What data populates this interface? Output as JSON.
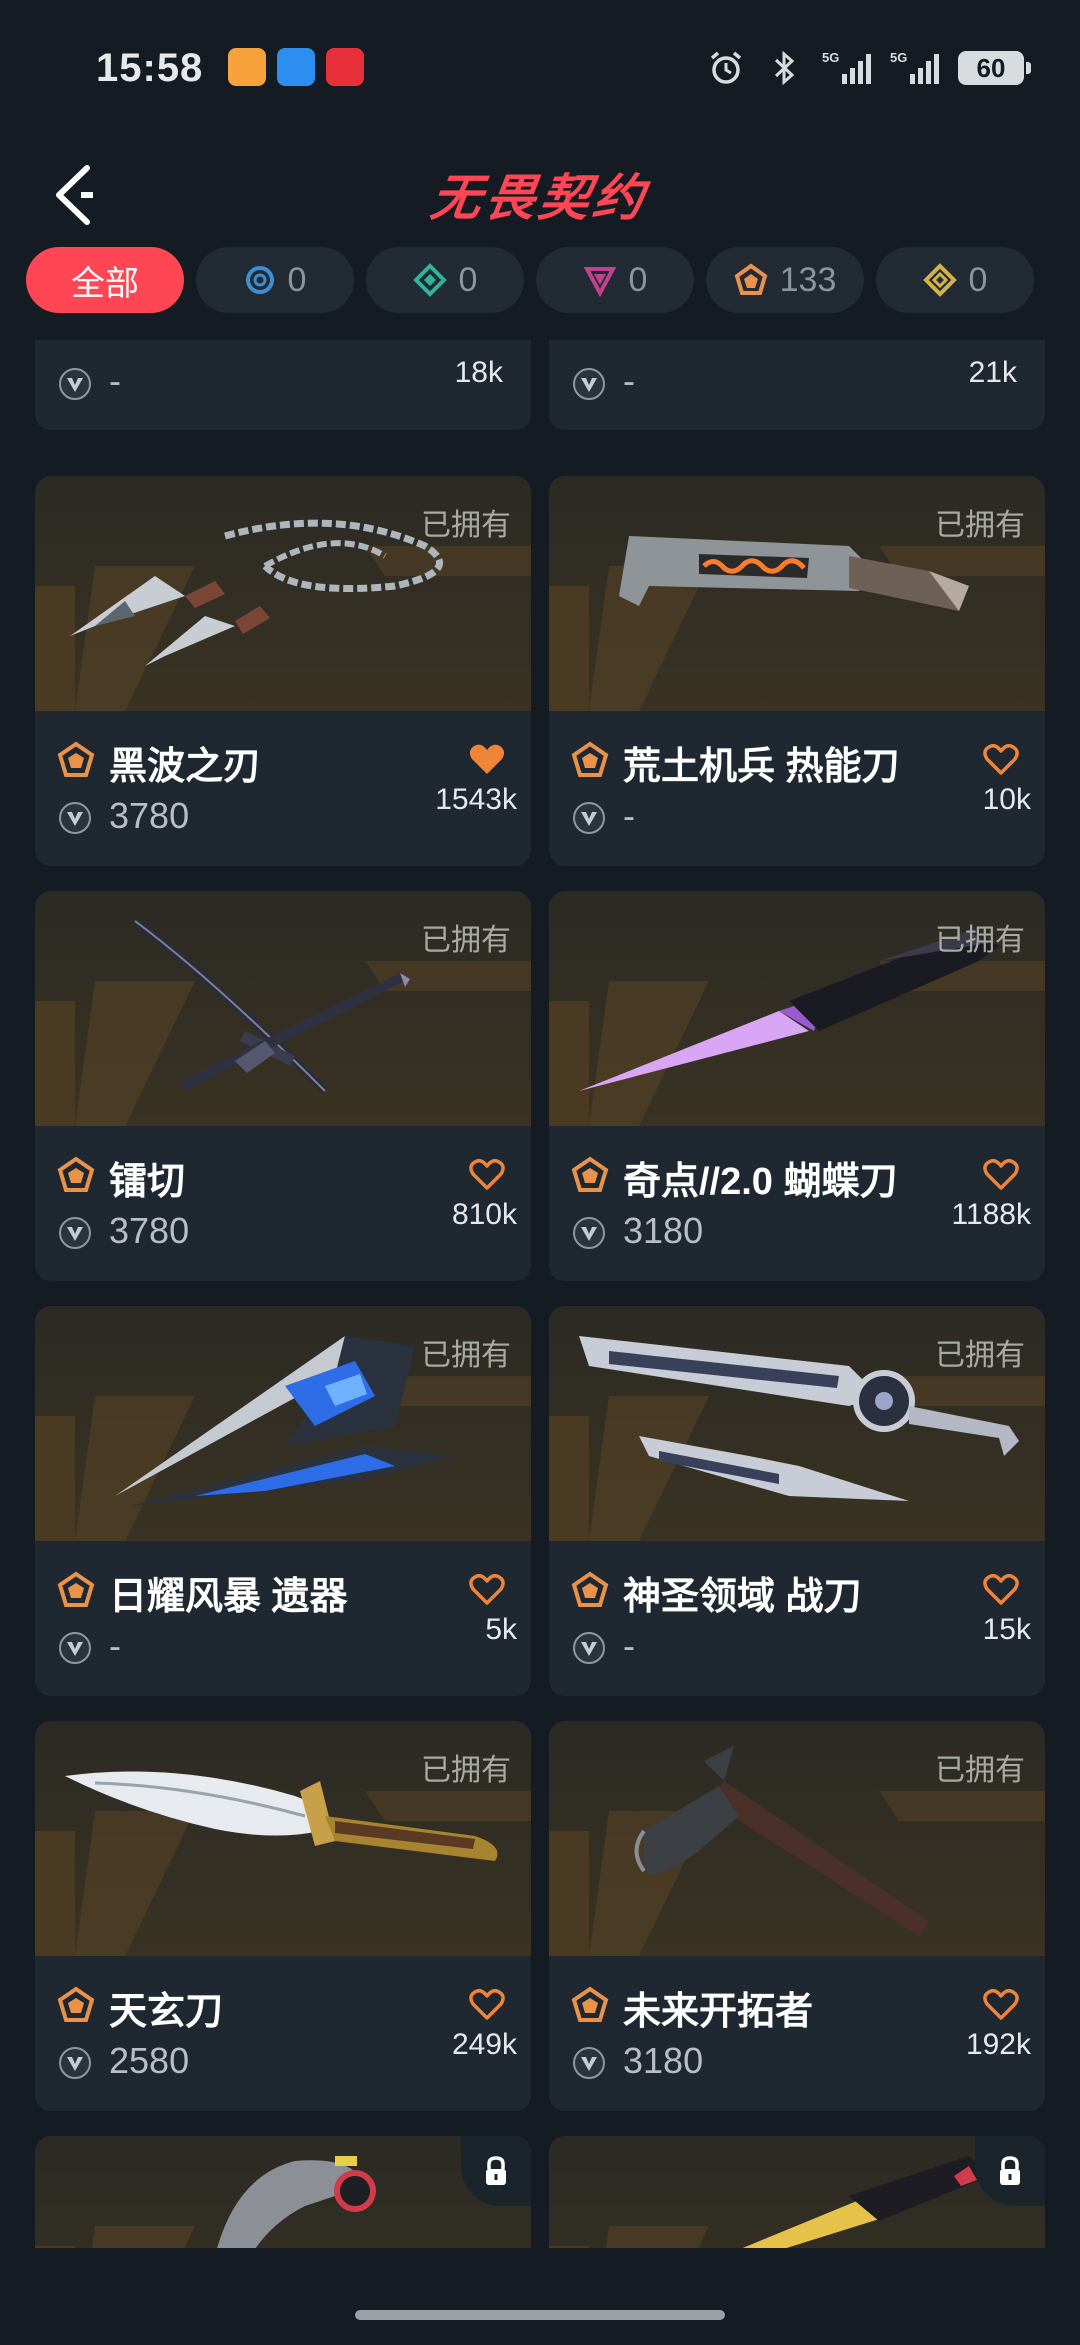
{
  "status_bar": {
    "time": "15:58",
    "battery": "60"
  },
  "header": {
    "title": "无畏契约"
  },
  "tabs": [
    {
      "label": "全部"
    },
    {
      "label": "0",
      "tier": "select"
    },
    {
      "label": "0",
      "tier": "deluxe"
    },
    {
      "label": "0",
      "tier": "premium"
    },
    {
      "label": "133",
      "tier": "exclusive"
    },
    {
      "label": "0",
      "tier": "ultra"
    }
  ],
  "partial_cards": [
    {
      "price": "-",
      "likes": "18k"
    },
    {
      "price": "-",
      "likes": "21k"
    }
  ],
  "cards": [
    {
      "name": "黑波之刃",
      "owned_label": "已拥有",
      "price": "3780",
      "likes": "1543k",
      "favorited": true
    },
    {
      "name": "荒土机兵 热能刀",
      "owned_label": "已拥有",
      "price": "-",
      "likes": "10k",
      "favorited": false
    },
    {
      "name": "镭切",
      "owned_label": "已拥有",
      "price": "3780",
      "likes": "810k",
      "favorited": false
    },
    {
      "name": "奇点//2.0 蝴蝶刀",
      "owned_label": "已拥有",
      "price": "3180",
      "likes": "1188k",
      "favorited": false
    },
    {
      "name": "日耀风暴 遗器",
      "owned_label": "已拥有",
      "price": "-",
      "likes": "5k",
      "favorited": false
    },
    {
      "name": "神圣领域 战刀",
      "owned_label": "已拥有",
      "price": "-",
      "likes": "15k",
      "favorited": false
    },
    {
      "name": "天玄刀",
      "owned_label": "已拥有",
      "price": "2580",
      "likes": "249k",
      "favorited": false
    },
    {
      "name": "未来开拓者",
      "owned_label": "已拥有",
      "price": "3180",
      "likes": "192k",
      "favorited": false
    }
  ],
  "colors": {
    "accent": "#ff4654",
    "exclusive_tier": "#e8924a",
    "background": "#151b22",
    "card": "#1f2831"
  }
}
